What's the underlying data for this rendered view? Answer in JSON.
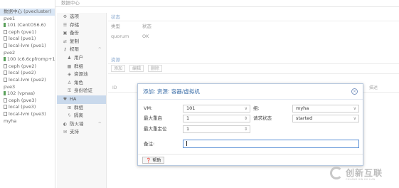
{
  "tree": {
    "items": [
      {
        "label": "数据中心 (pvecluster)",
        "type": "dc",
        "selected": true
      },
      {
        "label": "pve1",
        "type": "node"
      },
      {
        "label": "101 (CentOS6.6)",
        "type": "vm"
      },
      {
        "label": "ceph (pve1)",
        "type": "storage"
      },
      {
        "label": "local (pve1)",
        "type": "storage"
      },
      {
        "label": "local-lvm (pve1)",
        "type": "storage"
      },
      {
        "label": "pve2",
        "type": "node"
      },
      {
        "label": "100 (c6.6cpfromp+1)",
        "type": "vm"
      },
      {
        "label": "ceph (pve2)",
        "type": "storage"
      },
      {
        "label": "local (pve2)",
        "type": "storage"
      },
      {
        "label": "local-lvm (pve2)",
        "type": "storage"
      },
      {
        "label": "pve3",
        "type": "node"
      },
      {
        "label": "102 (vpnas)",
        "type": "vm"
      },
      {
        "label": "ceph (pve3)",
        "type": "storage"
      },
      {
        "label": "local (pve3)",
        "type": "storage"
      },
      {
        "label": "local-lvm (pve3)",
        "type": "storage"
      },
      {
        "label": "myha",
        "type": "pool"
      }
    ]
  },
  "topbar": {
    "title": "数据中心"
  },
  "nav": {
    "items": [
      {
        "label": "选项",
        "icon": "gear-icon",
        "sub": false
      },
      {
        "label": "存储",
        "icon": "database-icon",
        "sub": false
      },
      {
        "label": "备份",
        "icon": "floppy-icon",
        "sub": false
      },
      {
        "label": "复制",
        "icon": "replicate-icon",
        "sub": false
      },
      {
        "label": "权限",
        "icon": "key-icon",
        "sub": false,
        "caret": "^"
      },
      {
        "label": "用户",
        "icon": "user-icon",
        "sub": true
      },
      {
        "label": "群组",
        "icon": "group-icon",
        "sub": true
      },
      {
        "label": "资源池",
        "icon": "tag-icon",
        "sub": true
      },
      {
        "label": "角色",
        "icon": "male-icon",
        "sub": true
      },
      {
        "label": "身份验证",
        "icon": "keyhole-icon",
        "sub": true
      },
      {
        "label": "HA",
        "icon": "heartbeat-icon",
        "sub": false,
        "selected": true
      },
      {
        "label": "群组",
        "icon": "object-group-icon",
        "sub": true
      },
      {
        "label": "隔离",
        "icon": "bolt-icon",
        "sub": true
      },
      {
        "label": "防火墙",
        "icon": "shield-icon",
        "sub": false,
        "caret": "^"
      },
      {
        "label": "支持",
        "icon": "comments-icon",
        "sub": false
      }
    ]
  },
  "status": {
    "title": "状态",
    "rows": [
      {
        "key": "类型",
        "value": "状态"
      },
      {
        "key": "quorum",
        "value": "OK"
      }
    ]
  },
  "resources": {
    "title": "资源",
    "toolbar": [
      "添加",
      "编辑",
      "删除"
    ],
    "col_id": "ID",
    "col_desc": "描述"
  },
  "dialog": {
    "title": "添加: 资源: 容器/虚拟机",
    "close_glyph": "×",
    "vm_label": "VM:",
    "vm_value": "101",
    "group_label": "组:",
    "group_value": "myha",
    "max_restart_label": "最大重启",
    "max_restart_value": "1",
    "req_state_label": "请求状态",
    "req_state_value": "started",
    "max_relocate_label": "最大重定位",
    "max_relocate_value": "1",
    "comment_label": "备注:",
    "comment_value": "",
    "help_label": "帮助"
  },
  "watermark": {
    "text": "创新互联",
    "sub": "CHUANG XIN HU LIAN"
  }
}
